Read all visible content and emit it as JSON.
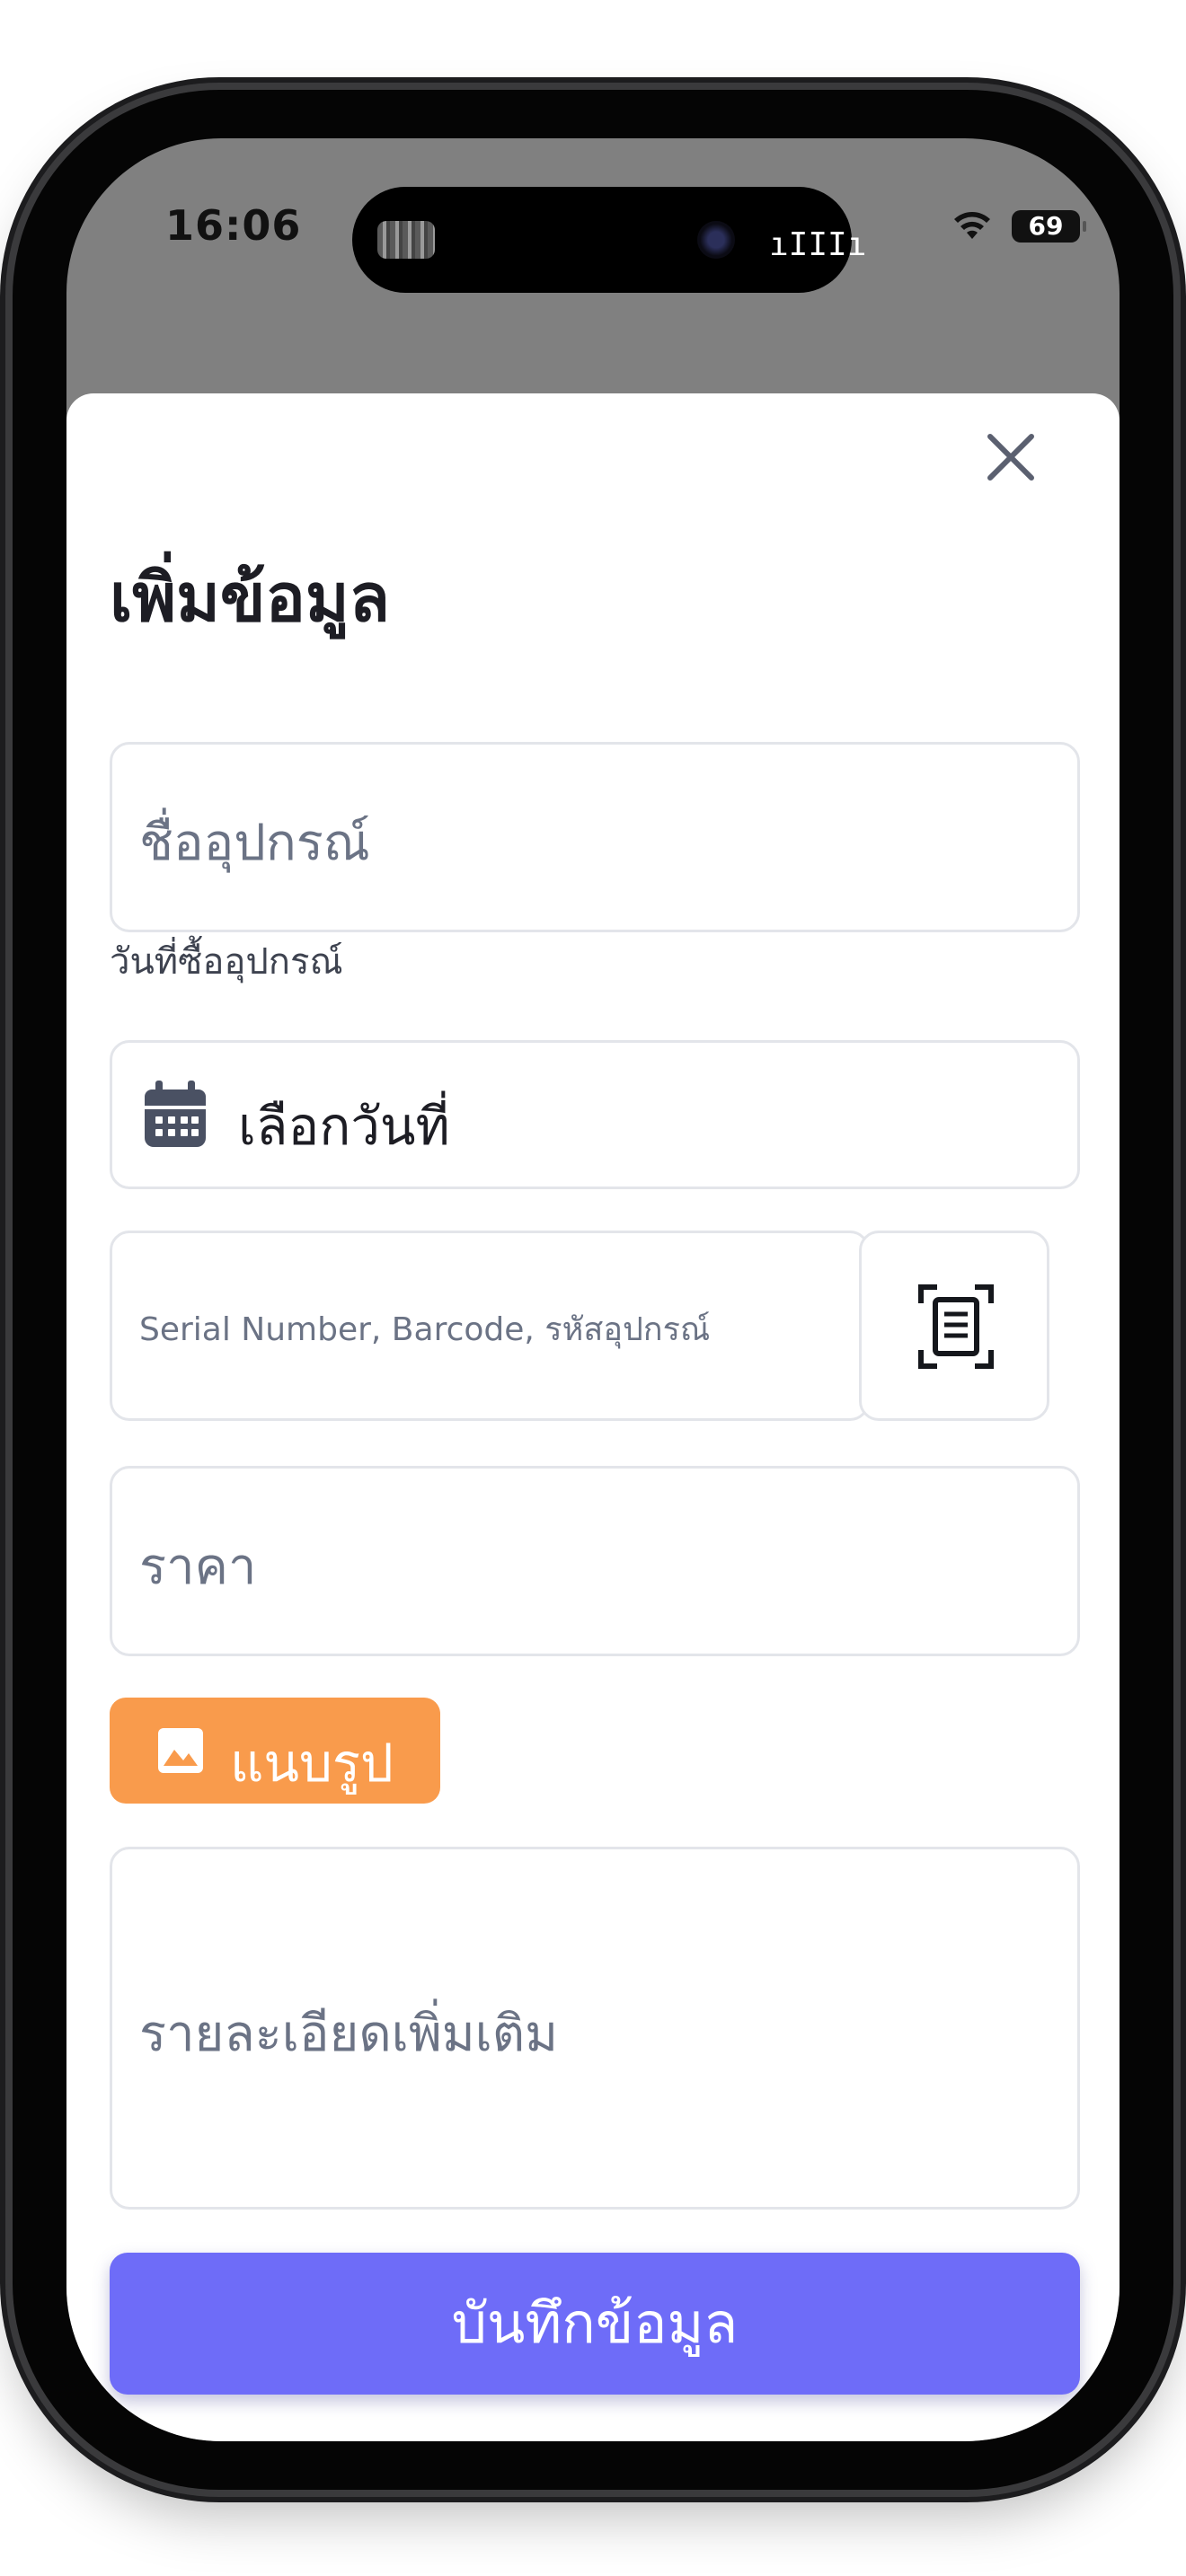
{
  "status_bar": {
    "time": "16:06",
    "battery": "69"
  },
  "form": {
    "title": "เพิ่มข้อมูล",
    "device_name_placeholder": "ชื่ออุปกรณ์",
    "purchase_date_label": "วันที่ซื้ออุปกรณ์",
    "date_picker_text": "เลือกวันที่",
    "serial_placeholder": "Serial Number, Barcode, รหัสอุปกรณ์",
    "price_placeholder": "ราคา",
    "attach_label": "แนบรูป",
    "details_placeholder": "รายละเอียดเพิ่มเติม",
    "save_label": "บันทึกข้อมูล"
  },
  "colors": {
    "accent": "#6e6cf8",
    "attach": "#f99b4c",
    "border": "#e3e5ea",
    "placeholder": "#6b7385"
  },
  "icons": [
    "close-icon",
    "calendar-icon",
    "scan-document-icon",
    "image-icon",
    "wifi-icon",
    "battery-icon"
  ]
}
